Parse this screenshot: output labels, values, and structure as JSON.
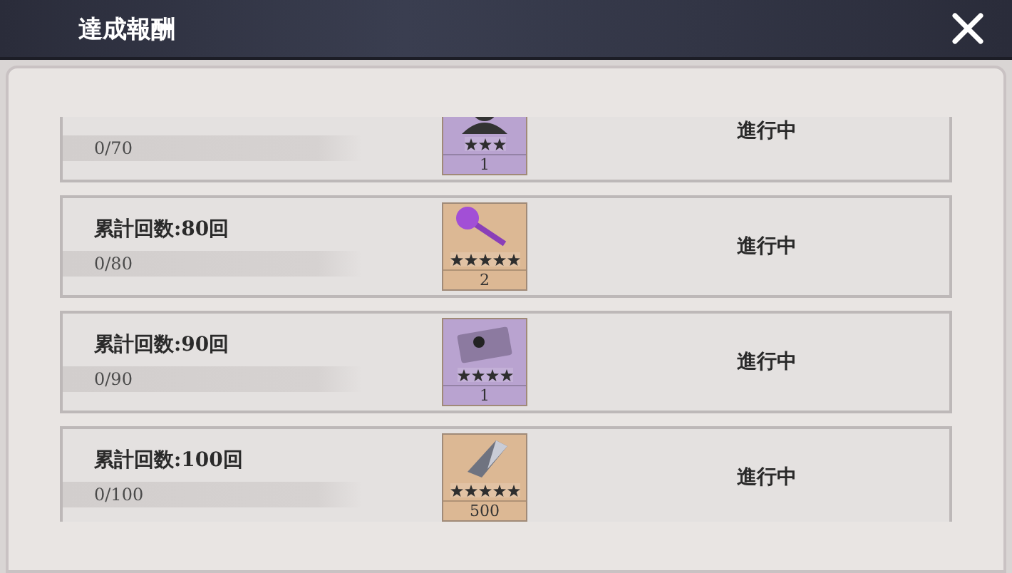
{
  "window": {
    "title": "達成報酬"
  },
  "rewards": [
    {
      "progress": "0/70",
      "level": 0,
      "item": {
        "kind": "character",
        "color": "#b9a3d0",
        "stars": 3,
        "count": "1"
      },
      "status": "進行中"
    },
    {
      "title": "累計回数:80回",
      "progress": "0/80",
      "level": 0,
      "item": {
        "kind": "staff",
        "color": "#dcb894",
        "stars": 5,
        "count": "2"
      },
      "status": "進行中"
    },
    {
      "title": "累計回数:90回",
      "progress": "0/90",
      "level": 0,
      "item": {
        "kind": "ticket",
        "color": "#b9a3d0",
        "stars": 4,
        "count": "1"
      },
      "status": "進行中"
    },
    {
      "title": "累計回数:100回",
      "progress": "0/100",
      "level": 0,
      "item": {
        "kind": "crystal",
        "color": "#dcb894",
        "stars": 5,
        "count": "500"
      },
      "status": "進行中"
    }
  ]
}
